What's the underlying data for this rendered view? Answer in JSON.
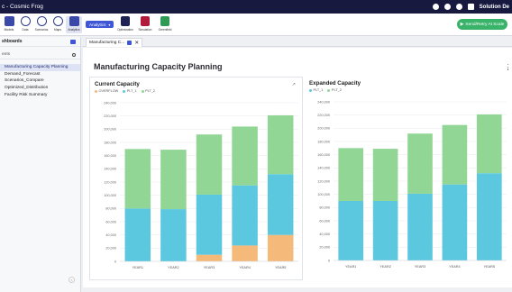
{
  "titlebar": {
    "title": "c - Cosmic Frog",
    "user": "Solution De",
    "icons": [
      "people-icon",
      "help-icon",
      "chat-icon",
      "bell-icon"
    ]
  },
  "toolbar": {
    "tools": [
      {
        "label": "Models",
        "icon": "grid-icon"
      },
      {
        "label": "Data",
        "icon": "database-icon"
      },
      {
        "label": "Scenarios",
        "icon": "scenarios-icon"
      },
      {
        "label": "Maps",
        "icon": "map-pin-icon"
      },
      {
        "label": "Analytics",
        "icon": "analytics-icon"
      }
    ],
    "analytics_button": "Analytics",
    "ext_tools": [
      {
        "label": "Optimization",
        "icon": "optimization-icon",
        "color": "#1d2252"
      },
      {
        "label": "Simulation",
        "icon": "simulation-icon",
        "color": "#b11a3a"
      },
      {
        "label": "Greenfield",
        "icon": "greenfield-icon",
        "color": "#2e9a55"
      }
    ],
    "run_button": "Send/Retry At Scale"
  },
  "sidebar": {
    "header": "shboards",
    "search_value": "ents",
    "items": [
      {
        "label": "Manufacturing Capacity Planning",
        "active": true
      },
      {
        "label": "Demand_Forecast",
        "active": false
      },
      {
        "label": "Scenarios_Compare",
        "active": false
      },
      {
        "label": "Optimized_Distribution",
        "active": false
      },
      {
        "label": "Facility Risk Summary",
        "active": false
      }
    ]
  },
  "tabs": [
    {
      "label": "Manufacturing C..."
    }
  ],
  "main": {
    "title": "Manufacturing Capacity Planning"
  },
  "colors": {
    "overflow": "#f5b97a",
    "plt1": "#5bc8df",
    "plt2": "#92d696",
    "accent": "#3f57d6",
    "run": "#39b36a"
  },
  "chart_data": [
    {
      "type": "bar",
      "stacked": true,
      "title": "Current Capacity",
      "categories": [
        "YEAR1",
        "YEAR2",
        "YEAR3",
        "YEAR4",
        "YEAR5"
      ],
      "series": [
        {
          "name": "OVERFLOW",
          "color": "#f5b97a",
          "values": [
            0,
            0,
            10000,
            24000,
            40000
          ]
        },
        {
          "name": "PLT_1",
          "color": "#5bc8df",
          "values": [
            80000,
            79000,
            91000,
            91000,
            92000
          ]
        },
        {
          "name": "PLT_2",
          "color": "#92d696",
          "values": [
            90000,
            90000,
            91000,
            89000,
            89000
          ]
        }
      ],
      "yticks": [
        "0",
        "20,000",
        "40,000",
        "60,000",
        "80,000",
        "100,000",
        "120,000",
        "140,000",
        "160,000",
        "180,000",
        "200,000",
        "220,000",
        "240,000"
      ],
      "ylim": [
        0,
        240000
      ],
      "grid": true,
      "legend": "top-left"
    },
    {
      "type": "bar",
      "stacked": true,
      "title": "Expanded Capacity",
      "categories": [
        "YEAR1",
        "YEAR2",
        "YEAR3",
        "YEAR4",
        "YEAR5"
      ],
      "series": [
        {
          "name": "PLT_1",
          "color": "#5bc8df",
          "values": [
            90000,
            90000,
            101000,
            115000,
            132000
          ]
        },
        {
          "name": "PLT_2",
          "color": "#92d696",
          "values": [
            80000,
            79000,
            91000,
            90000,
            89000
          ]
        }
      ],
      "yticks": [
        "0",
        "20,000",
        "40,000",
        "60,000",
        "80,000",
        "100,000",
        "120,000",
        "140,000",
        "160,000",
        "180,000",
        "200,000",
        "220,000",
        "240,000"
      ],
      "ylim": [
        0,
        240000
      ],
      "grid": true,
      "legend": "top-left"
    }
  ]
}
